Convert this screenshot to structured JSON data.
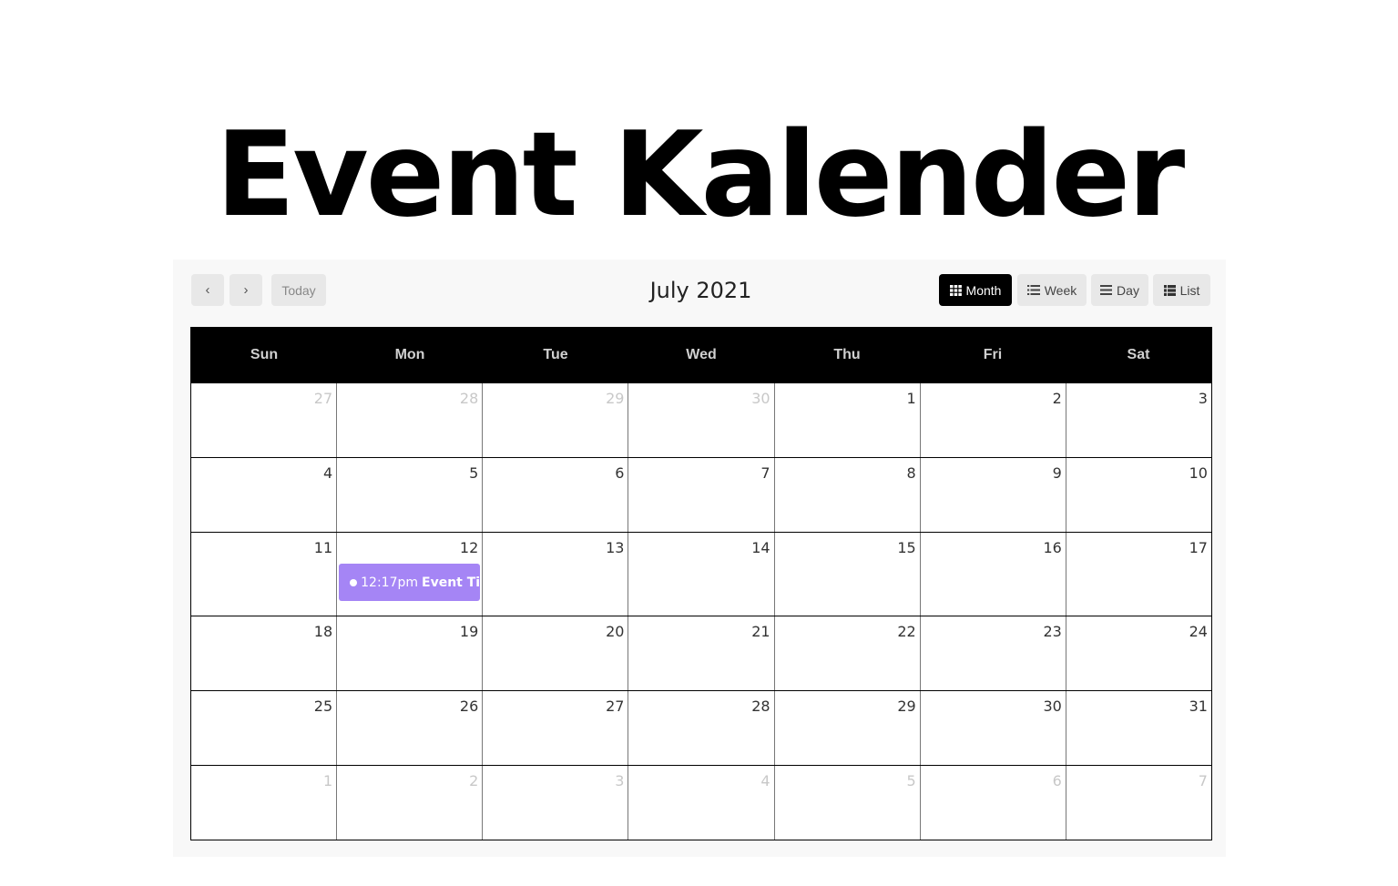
{
  "hero": {
    "title": "Event Kalender"
  },
  "calendar": {
    "title": "July 2021",
    "nav": {
      "prev_icon": "‹",
      "next_icon": "›",
      "today_label": "Today"
    },
    "views": [
      {
        "label": "Month",
        "icon": "grid-icon",
        "active": true
      },
      {
        "label": "Week",
        "icon": "list-bulleted-icon",
        "active": false
      },
      {
        "label": "Day",
        "icon": "list-lines-icon",
        "active": false
      },
      {
        "label": "List",
        "icon": "table-list-icon",
        "active": false
      }
    ],
    "weekdays": [
      "Sun",
      "Mon",
      "Tue",
      "Wed",
      "Thu",
      "Fri",
      "Sat"
    ],
    "weeks": [
      [
        {
          "d": "27",
          "other": true
        },
        {
          "d": "28",
          "other": true
        },
        {
          "d": "29",
          "other": true
        },
        {
          "d": "30",
          "other": true
        },
        {
          "d": "1"
        },
        {
          "d": "2"
        },
        {
          "d": "3"
        }
      ],
      [
        {
          "d": "4"
        },
        {
          "d": "5"
        },
        {
          "d": "6"
        },
        {
          "d": "7"
        },
        {
          "d": "8"
        },
        {
          "d": "9"
        },
        {
          "d": "10"
        }
      ],
      [
        {
          "d": "11"
        },
        {
          "d": "12",
          "event": {
            "time": "12:17pm",
            "title": "Event Title"
          }
        },
        {
          "d": "13"
        },
        {
          "d": "14"
        },
        {
          "d": "15"
        },
        {
          "d": "16"
        },
        {
          "d": "17"
        }
      ],
      [
        {
          "d": "18"
        },
        {
          "d": "19"
        },
        {
          "d": "20"
        },
        {
          "d": "21"
        },
        {
          "d": "22"
        },
        {
          "d": "23"
        },
        {
          "d": "24"
        }
      ],
      [
        {
          "d": "25"
        },
        {
          "d": "26"
        },
        {
          "d": "27"
        },
        {
          "d": "28"
        },
        {
          "d": "29"
        },
        {
          "d": "30"
        },
        {
          "d": "31"
        }
      ],
      [
        {
          "d": "1",
          "other": true
        },
        {
          "d": "2",
          "other": true
        },
        {
          "d": "3",
          "other": true
        },
        {
          "d": "4",
          "other": true
        },
        {
          "d": "5",
          "other": true
        },
        {
          "d": "6",
          "other": true
        },
        {
          "d": "7",
          "other": true
        }
      ]
    ],
    "colors": {
      "event_bg": "#a585f5",
      "active_view_bg": "#000000",
      "header_bg": "#000000"
    }
  }
}
